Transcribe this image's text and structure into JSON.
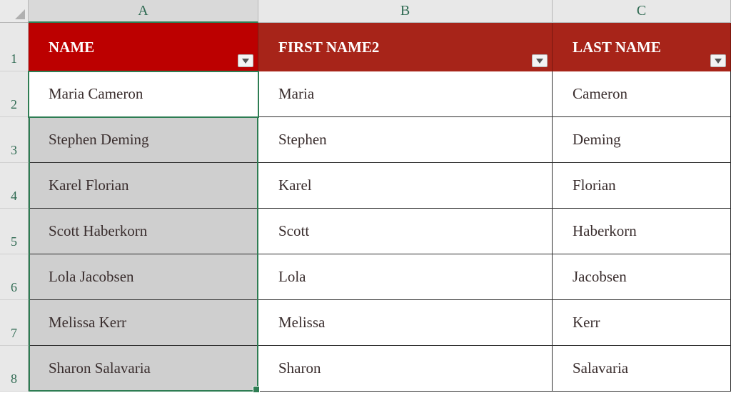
{
  "columns": {
    "letters": [
      "A",
      "B",
      "C"
    ],
    "active_index": 0
  },
  "header": {
    "labels": [
      "NAME",
      "FIRST NAME2",
      "LAST NAME"
    ]
  },
  "rows": [
    {
      "n": 2,
      "name": "Maria Cameron",
      "first": "Maria",
      "last": "Cameron"
    },
    {
      "n": 3,
      "name": "Stephen Deming",
      "first": "Stephen",
      "last": "Deming"
    },
    {
      "n": 4,
      "name": "Karel Florian",
      "first": "Karel",
      "last": "Florian"
    },
    {
      "n": 5,
      "name": "Scott Haberkorn",
      "first": "Scott",
      "last": "Haberkorn"
    },
    {
      "n": 6,
      "name": "Lola Jacobsen",
      "first": "Lola",
      "last": "Jacobsen"
    },
    {
      "n": 7,
      "name": "Melissa Kerr",
      "first": "Melissa",
      "last": "Kerr"
    },
    {
      "n": 8,
      "name": "Sharon Salavaria",
      "first": "Sharon",
      "last": "Salavaria"
    }
  ],
  "header_row_number": 1,
  "active_cell": "A2",
  "selection_range": "A2:A8",
  "colors": {
    "header_bg": "#a72419",
    "header_bg_active": "#bc0000",
    "selection": "#2e7d53"
  }
}
